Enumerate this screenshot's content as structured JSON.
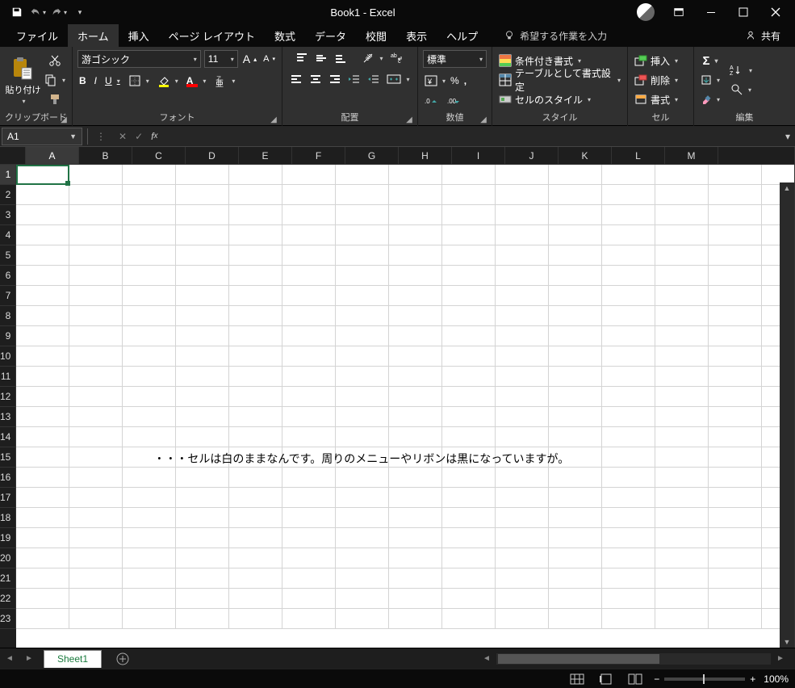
{
  "title": "Book1 - Excel",
  "tabs": {
    "file": "ファイル",
    "home": "ホーム",
    "insert": "挿入",
    "layout": "ページ レイアウト",
    "formulas": "数式",
    "data": "データ",
    "review": "校閲",
    "view": "表示",
    "help": "ヘルプ",
    "tellme": "希望する作業を入力"
  },
  "share": "共有",
  "ribbon": {
    "clipboard": {
      "paste": "貼り付け",
      "label": "クリップボード"
    },
    "font": {
      "name": "游ゴシック",
      "size": "11",
      "label": "フォント"
    },
    "align": {
      "label": "配置"
    },
    "number": {
      "format": "標準",
      "label": "数値"
    },
    "styles": {
      "cond": "条件付き書式",
      "table": "テーブルとして書式設定",
      "cell": "セルのスタイル",
      "label": "スタイル"
    },
    "cells": {
      "insert": "挿入",
      "delete": "削除",
      "format": "書式",
      "label": "セル"
    },
    "editing": {
      "label": "編集"
    }
  },
  "namebox": "A1",
  "columns": [
    "A",
    "B",
    "C",
    "D",
    "E",
    "F",
    "G",
    "H",
    "I",
    "J",
    "K",
    "L",
    "M"
  ],
  "rows": [
    "1",
    "2",
    "3",
    "4",
    "5",
    "6",
    "7",
    "8",
    "9",
    "10",
    "11",
    "12",
    "13",
    "14",
    "15",
    "16",
    "17",
    "18",
    "19",
    "20",
    "21",
    "22",
    "23"
  ],
  "gridtext": "・・・セルは白のままなんです。周りのメニューやリボンは黒になっていますが。",
  "sheet": "Sheet1",
  "zoom": "100%"
}
